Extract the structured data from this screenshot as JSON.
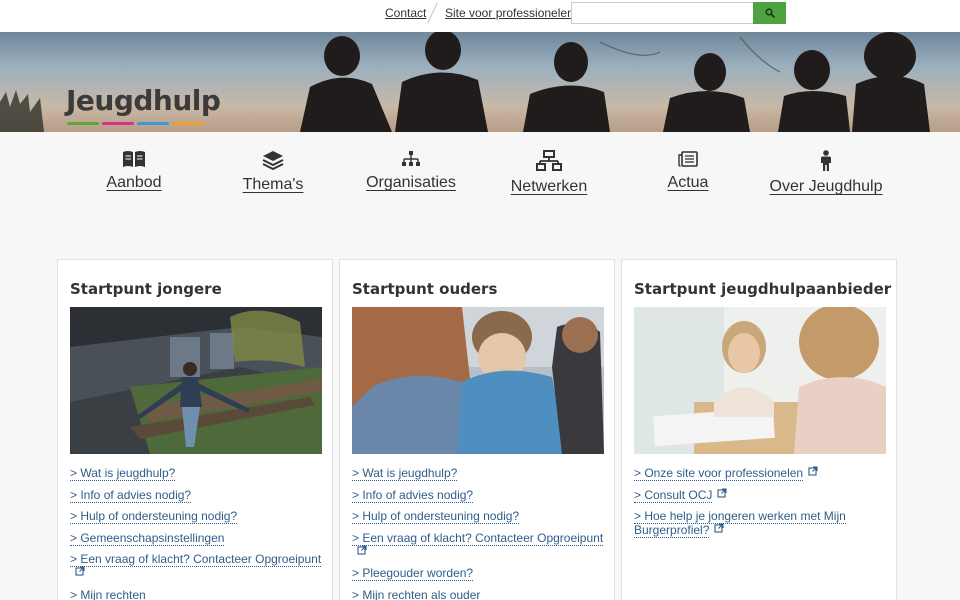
{
  "topbar": {
    "contact": "Contact",
    "professionals": "Site voor professionelen",
    "search_placeholder": "",
    "search_button_icon": "search-icon",
    "accent": "#4ea240"
  },
  "hero": {
    "logo": "Jeugdhulp",
    "logo_colors": [
      "#5aa83a",
      "#d6338a",
      "#3a9ad9",
      "#f0a030"
    ]
  },
  "nav": {
    "items": [
      {
        "label": "Aanbod",
        "icon": "open-book-icon"
      },
      {
        "label": "Thema's",
        "icon": "layers-icon"
      },
      {
        "label": "Organisaties",
        "icon": "org-chart-icon"
      },
      {
        "label": "Netwerken",
        "icon": "network-icon"
      },
      {
        "label": "Actua",
        "icon": "newspaper-icon"
      },
      {
        "label": "Over Jeugdhulp",
        "icon": "person-icon"
      }
    ]
  },
  "cards": [
    {
      "title": "Startpunt jongere",
      "links": [
        {
          "text": "Wat is jeugdhulp?",
          "external": false
        },
        {
          "text": "Info of advies nodig?",
          "external": false
        },
        {
          "text": "Hulp of ondersteuning nodig?",
          "external": false
        },
        {
          "text": "Gemeenschapsinstellingen",
          "external": false
        },
        {
          "text": "Een vraag of klacht? Contacteer Opgroeipunt",
          "external": true
        },
        {
          "text": "Mijn rechten",
          "external": false
        }
      ]
    },
    {
      "title": "Startpunt ouders",
      "links": [
        {
          "text": "Wat is jeugdhulp?",
          "external": false
        },
        {
          "text": "Info of advies nodig?",
          "external": false
        },
        {
          "text": "Hulp of ondersteuning nodig?",
          "external": false
        },
        {
          "text": "Een vraag of klacht? Contacteer Opgroeipunt",
          "external": true
        },
        {
          "text": "Pleegouder worden?",
          "external": false
        },
        {
          "text": "Mijn rechten als ouder",
          "external": false
        }
      ]
    },
    {
      "title": "Startpunt jeugdhulpaanbieder",
      "links": [
        {
          "text": "Onze site voor professionelen",
          "external": true
        },
        {
          "text": "Consult OCJ",
          "external": true
        },
        {
          "text": "Hoe help je jongeren werken met Mijn Burgerprofiel?",
          "external": true
        }
      ]
    }
  ]
}
